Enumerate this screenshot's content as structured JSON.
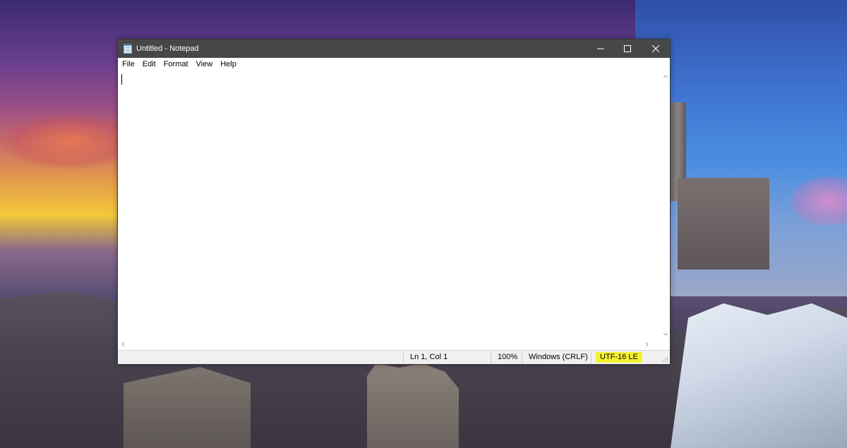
{
  "window": {
    "title": "Untitled - Notepad"
  },
  "menu": {
    "items": [
      "File",
      "Edit",
      "Format",
      "View",
      "Help"
    ]
  },
  "editor": {
    "content": ""
  },
  "statusbar": {
    "position": "Ln 1, Col 1",
    "zoom": "100%",
    "line_ending": "Windows (CRLF)",
    "encoding": "UTF-16 LE"
  },
  "colors": {
    "titlebar": "#474747",
    "encoding_highlight": "#f6f231",
    "statusbar_bg": "#f0f0f0"
  },
  "icons": {
    "app": "notepad-icon",
    "minimize": "minimize-icon",
    "maximize": "maximize-icon",
    "close": "close-icon"
  }
}
